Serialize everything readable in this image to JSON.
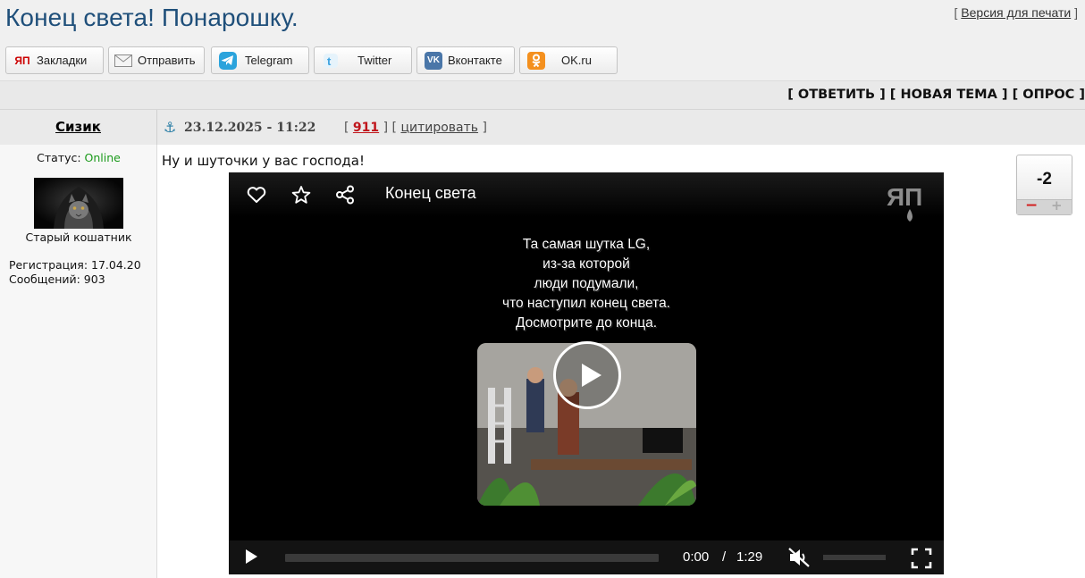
{
  "page": {
    "title": "Конец света! Понарошку.",
    "print_open": "[",
    "print_label": "Версия для печати",
    "print_close": "]"
  },
  "share": [
    {
      "label": "Закладки",
      "icon": "yap-icon",
      "color": "#cc0000"
    },
    {
      "label": "Отправить",
      "icon": "envelope-icon",
      "color": "#888888"
    },
    {
      "label": "Telegram",
      "icon": "telegram-icon",
      "color": "#2aa3dc"
    },
    {
      "label": "Twitter",
      "icon": "twitter-icon",
      "color": "#3fa3e0"
    },
    {
      "label": "Вконтакте",
      "icon": "vk-icon",
      "color": "#4a76a8"
    },
    {
      "label": "OK.ru",
      "icon": "odnoklassniki-icon",
      "color": "#f4901e"
    }
  ],
  "actions": {
    "reply": "[ ОТВЕТИТЬ ]",
    "new_topic": "[ НОВАЯ ТЕМА ]",
    "poll": "[ ОПРОС ]"
  },
  "post": {
    "author": "Сизик",
    "date": "23.12.2025 - 11:22",
    "number": "911",
    "quote": "цитировать",
    "bracket_open": "[",
    "bracket_close": "]",
    "text": "Ну и шуточки у вас господа!",
    "rating": "-2"
  },
  "profile": {
    "status_label": "Статус:",
    "status_value": "Online",
    "status_color": "#1b9a1b",
    "rank": "Старый кошатник",
    "registration": "Регистрация: 17.04.20",
    "messages": "Сообщений: 903"
  },
  "video": {
    "title": "Конец света",
    "logo": "ЯП",
    "caption_lines": [
      "Та самая шутка LG,",
      "из-за которой",
      "люди подумали,",
      "что наступил конец света.",
      "Досмотрите до конца."
    ],
    "current_time": "0:00",
    "separator": "/",
    "duration": "1:29",
    "progress": 0
  }
}
